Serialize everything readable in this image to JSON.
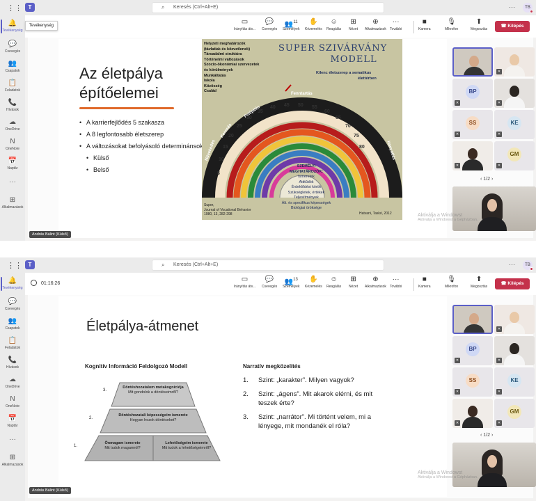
{
  "app": {
    "search_placeholder": "Keresés (Ctrl+Alt+E)",
    "more": "···",
    "user_initials": "TB"
  },
  "rail": [
    {
      "name": "activity",
      "icon": "🔔",
      "label": "Tevékenység"
    },
    {
      "name": "chat",
      "icon": "💬",
      "label": "Csevegés"
    },
    {
      "name": "teams",
      "icon": "👥",
      "label": "Csapatok"
    },
    {
      "name": "tasks",
      "icon": "📋",
      "label": "Feladatok"
    },
    {
      "name": "calls",
      "icon": "📞",
      "label": "Hívások"
    },
    {
      "name": "onedrive",
      "icon": "☁",
      "label": "OneDrive"
    },
    {
      "name": "onenote",
      "icon": "N",
      "label": "OneNote"
    },
    {
      "name": "calendar",
      "icon": "📅",
      "label": "Naptár"
    },
    {
      "name": "more",
      "icon": "···",
      "label": ""
    },
    {
      "name": "apps",
      "icon": "⊞",
      "label": "Alkalmazások"
    }
  ],
  "tooltip": "Tevékenység",
  "meeting_toolbar": {
    "timer": "01:16:26",
    "buttons": [
      {
        "name": "controls",
        "icon": "▭",
        "label": "Irányítás átv..."
      },
      {
        "name": "chat",
        "icon": "💬",
        "label": "Csevegés"
      },
      {
        "name": "people",
        "icon": "👥",
        "label": "Személyek"
      },
      {
        "name": "raise-hand",
        "icon": "✋",
        "label": "Kézemelés"
      },
      {
        "name": "react",
        "icon": "☺",
        "label": "Reagálás"
      },
      {
        "name": "view",
        "icon": "⊞",
        "label": "Nézet"
      },
      {
        "name": "apps",
        "icon": "⊕",
        "label": "Alkalmazások"
      },
      {
        "name": "more",
        "icon": "···",
        "label": "További"
      }
    ],
    "people_count": "11",
    "people_count_2": "13",
    "camera": {
      "icon": "■",
      "label": "Kamera"
    },
    "mic": {
      "icon": "🎙",
      "label": "Mikrofon"
    },
    "share": {
      "icon": "⬆",
      "label": "Megosztás"
    },
    "leave": "Kilépés"
  },
  "presenter_name": "András Bálint (Külső)",
  "participants": [
    {
      "type": "video",
      "label": ""
    },
    {
      "type": "video",
      "label": ""
    },
    {
      "type": "initials",
      "label": "BP"
    },
    {
      "type": "video",
      "label": ""
    },
    {
      "type": "initials",
      "label": "SS"
    },
    {
      "type": "initials",
      "label": "KE"
    },
    {
      "type": "video",
      "label": ""
    },
    {
      "type": "initials",
      "label": "GM"
    }
  ],
  "pager": "‹  1/2  ›",
  "watermark": {
    "line1": "Aktiválja a Windowst",
    "line2": "Aktiválja a Windowst a Gépházban."
  },
  "colors": {
    "accent": "#5b5fc7",
    "leave": "#c4314b",
    "bullet_line": "#e06a2b"
  },
  "slide1": {
    "title_line1": "Az életpálya",
    "title_line2": "építőelemei",
    "bullets": [
      "A karrierfejlődés 5 szakasza",
      "A 8 legfontosabb életszerep",
      "A változásokat befolyásoló determinánsok"
    ],
    "sub_bullets": [
      "Külső",
      "Belső"
    ],
    "rainbow": {
      "title_line1": "SUPER SZIVÁRVÁNY",
      "title_line2": "MODELL",
      "left_lines": [
        "Helyzeti meghatározók",
        "(távlatiak és közvetlenek)",
        "Társadalmi struktúra",
        "Történelmi változások",
        "Szocio-ökonómiai szervezetek",
        "és körülmények",
        "Munkáltatás",
        "Iskola",
        "Közösség",
        "Család"
      ],
      "right_lines": [
        "Kilenc életszerep a sematikus",
        "élettérben"
      ],
      "stages": [
        "Növekedés",
        "Keresés",
        "Felépítés",
        "Fenntartás",
        "Hanyatlás"
      ],
      "ages": [
        "5",
        "10",
        "15",
        "20",
        "25",
        "30",
        "35",
        "40",
        "45",
        "50",
        "55",
        "60",
        "65",
        "70",
        "75",
        "80"
      ],
      "self_lines": [
        "SZEMÉLYI",
        "MEGHATÁROZÓK:",
        "Ismeretek",
        "Attitűdök",
        "Érdeklődési körök",
        "Szükségletek, értékek",
        "Teljesítmények",
        "Ált. és specifikus képességek",
        "Biológiai öröksége"
      ],
      "footer_left": [
        "Super,",
        "Journal of Vocational Behavior",
        "1980, 13, 282-298"
      ],
      "footer_right": "Hatvani, Taskó, 2012"
    }
  },
  "slide2": {
    "title": "Életpálya-átmenet",
    "left_heading": "Kognitív Információ Feldolgozó Modell",
    "right_heading": "Narratív megközelítés",
    "pyramid": [
      {
        "num": "3.",
        "title": "Döntéshozatalom metakogníciója",
        "sub": "Mit gondolok a döntéseimről?"
      },
      {
        "num": "2.",
        "title": "Döntéshozatali képességeim ismerete",
        "sub": "Hogyan hozok döntéseket?"
      },
      {
        "num": "1.",
        "title": "Önmagam ismerete",
        "sub": "Mit tudok magamról?"
      },
      {
        "num": "",
        "title": "Lehetőségeim ismerete",
        "sub": "Mit tudok a lehetőségeimről?"
      }
    ],
    "narrative": [
      {
        "num": "1.",
        "text": "Szint: „karakter”. Milyen vagyok?"
      },
      {
        "num": "2.",
        "text": "Szint: „ágens”. Mit akarok elérni, és mit teszek érte?"
      },
      {
        "num": "3.",
        "text": "Szint: „narrátor”. Mi történt velem, mi a lényege, mit mondanék el róla?"
      }
    ]
  }
}
